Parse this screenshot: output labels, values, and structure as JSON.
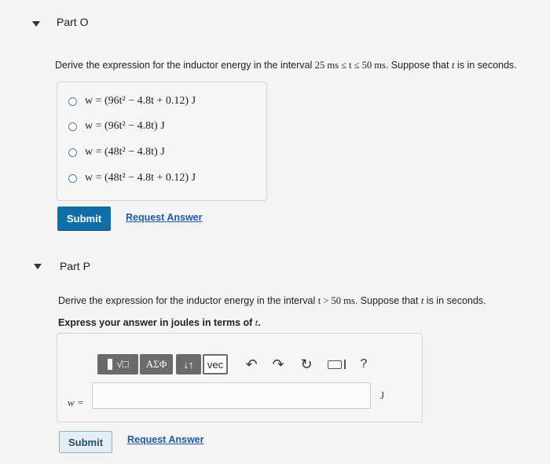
{
  "part_o": {
    "title": "Part O",
    "prompt_before": "Derive the expression for the inductor energy in the interval ",
    "prompt_math": "25 ms ≤ t ≤ 50 ms",
    "prompt_after": ". Suppose that ",
    "prompt_var": "t",
    "prompt_end": " is in seconds.",
    "options": [
      "w = (96t² − 4.8t + 0.12) J",
      "w = (96t² − 4.8t) J",
      "w = (48t² − 4.8t) J",
      "w = (48t² − 4.8t + 0.12) J"
    ],
    "submit_label": "Submit",
    "request_label": "Request Answer"
  },
  "part_p": {
    "title": "Part P",
    "prompt_before": "Derive the expression for the inductor energy in the interval ",
    "prompt_math": "t > 50 ms",
    "prompt_after": ". Suppose that ",
    "prompt_var": "t",
    "prompt_end": " is in seconds.",
    "instruction_before": "Express your answer in joules in terms of ",
    "instruction_var": "t",
    "instruction_end": ".",
    "toolbar": {
      "templates_label": "√□",
      "greek_label": "ΑΣΦ",
      "arrows_label": "↓↑",
      "vec_label": "vec",
      "help_label": "?"
    },
    "answer_prefix": "w =",
    "answer_unit": "J",
    "answer_value": "",
    "submit_label": "Submit",
    "request_label": "Request Answer"
  }
}
